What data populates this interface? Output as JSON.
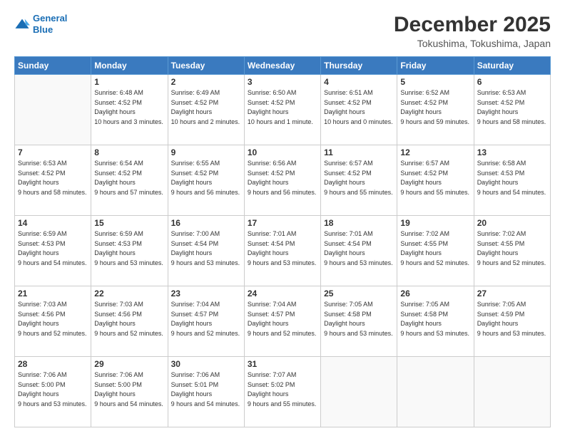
{
  "header": {
    "logo_line1": "General",
    "logo_line2": "Blue",
    "title": "December 2025",
    "subtitle": "Tokushima, Tokushima, Japan"
  },
  "calendar": {
    "headers": [
      "Sunday",
      "Monday",
      "Tuesday",
      "Wednesday",
      "Thursday",
      "Friday",
      "Saturday"
    ],
    "rows": [
      [
        {
          "day": "",
          "empty": true
        },
        {
          "day": "1",
          "sunrise": "6:48 AM",
          "sunset": "4:52 PM",
          "daylight": "10 hours and 3 minutes."
        },
        {
          "day": "2",
          "sunrise": "6:49 AM",
          "sunset": "4:52 PM",
          "daylight": "10 hours and 2 minutes."
        },
        {
          "day": "3",
          "sunrise": "6:50 AM",
          "sunset": "4:52 PM",
          "daylight": "10 hours and 1 minute."
        },
        {
          "day": "4",
          "sunrise": "6:51 AM",
          "sunset": "4:52 PM",
          "daylight": "10 hours and 0 minutes."
        },
        {
          "day": "5",
          "sunrise": "6:52 AM",
          "sunset": "4:52 PM",
          "daylight": "9 hours and 59 minutes."
        },
        {
          "day": "6",
          "sunrise": "6:53 AM",
          "sunset": "4:52 PM",
          "daylight": "9 hours and 58 minutes."
        }
      ],
      [
        {
          "day": "7",
          "sunrise": "6:53 AM",
          "sunset": "4:52 PM",
          "daylight": "9 hours and 58 minutes."
        },
        {
          "day": "8",
          "sunrise": "6:54 AM",
          "sunset": "4:52 PM",
          "daylight": "9 hours and 57 minutes."
        },
        {
          "day": "9",
          "sunrise": "6:55 AM",
          "sunset": "4:52 PM",
          "daylight": "9 hours and 56 minutes."
        },
        {
          "day": "10",
          "sunrise": "6:56 AM",
          "sunset": "4:52 PM",
          "daylight": "9 hours and 56 minutes."
        },
        {
          "day": "11",
          "sunrise": "6:57 AM",
          "sunset": "4:52 PM",
          "daylight": "9 hours and 55 minutes."
        },
        {
          "day": "12",
          "sunrise": "6:57 AM",
          "sunset": "4:52 PM",
          "daylight": "9 hours and 55 minutes."
        },
        {
          "day": "13",
          "sunrise": "6:58 AM",
          "sunset": "4:53 PM",
          "daylight": "9 hours and 54 minutes."
        }
      ],
      [
        {
          "day": "14",
          "sunrise": "6:59 AM",
          "sunset": "4:53 PM",
          "daylight": "9 hours and 54 minutes."
        },
        {
          "day": "15",
          "sunrise": "6:59 AM",
          "sunset": "4:53 PM",
          "daylight": "9 hours and 53 minutes."
        },
        {
          "day": "16",
          "sunrise": "7:00 AM",
          "sunset": "4:54 PM",
          "daylight": "9 hours and 53 minutes."
        },
        {
          "day": "17",
          "sunrise": "7:01 AM",
          "sunset": "4:54 PM",
          "daylight": "9 hours and 53 minutes."
        },
        {
          "day": "18",
          "sunrise": "7:01 AM",
          "sunset": "4:54 PM",
          "daylight": "9 hours and 53 minutes."
        },
        {
          "day": "19",
          "sunrise": "7:02 AM",
          "sunset": "4:55 PM",
          "daylight": "9 hours and 52 minutes."
        },
        {
          "day": "20",
          "sunrise": "7:02 AM",
          "sunset": "4:55 PM",
          "daylight": "9 hours and 52 minutes."
        }
      ],
      [
        {
          "day": "21",
          "sunrise": "7:03 AM",
          "sunset": "4:56 PM",
          "daylight": "9 hours and 52 minutes."
        },
        {
          "day": "22",
          "sunrise": "7:03 AM",
          "sunset": "4:56 PM",
          "daylight": "9 hours and 52 minutes."
        },
        {
          "day": "23",
          "sunrise": "7:04 AM",
          "sunset": "4:57 PM",
          "daylight": "9 hours and 52 minutes."
        },
        {
          "day": "24",
          "sunrise": "7:04 AM",
          "sunset": "4:57 PM",
          "daylight": "9 hours and 52 minutes."
        },
        {
          "day": "25",
          "sunrise": "7:05 AM",
          "sunset": "4:58 PM",
          "daylight": "9 hours and 53 minutes."
        },
        {
          "day": "26",
          "sunrise": "7:05 AM",
          "sunset": "4:58 PM",
          "daylight": "9 hours and 53 minutes."
        },
        {
          "day": "27",
          "sunrise": "7:05 AM",
          "sunset": "4:59 PM",
          "daylight": "9 hours and 53 minutes."
        }
      ],
      [
        {
          "day": "28",
          "sunrise": "7:06 AM",
          "sunset": "5:00 PM",
          "daylight": "9 hours and 53 minutes."
        },
        {
          "day": "29",
          "sunrise": "7:06 AM",
          "sunset": "5:00 PM",
          "daylight": "9 hours and 54 minutes."
        },
        {
          "day": "30",
          "sunrise": "7:06 AM",
          "sunset": "5:01 PM",
          "daylight": "9 hours and 54 minutes."
        },
        {
          "day": "31",
          "sunrise": "7:07 AM",
          "sunset": "5:02 PM",
          "daylight": "9 hours and 55 minutes."
        },
        {
          "day": "",
          "empty": true
        },
        {
          "day": "",
          "empty": true
        },
        {
          "day": "",
          "empty": true
        }
      ]
    ]
  }
}
